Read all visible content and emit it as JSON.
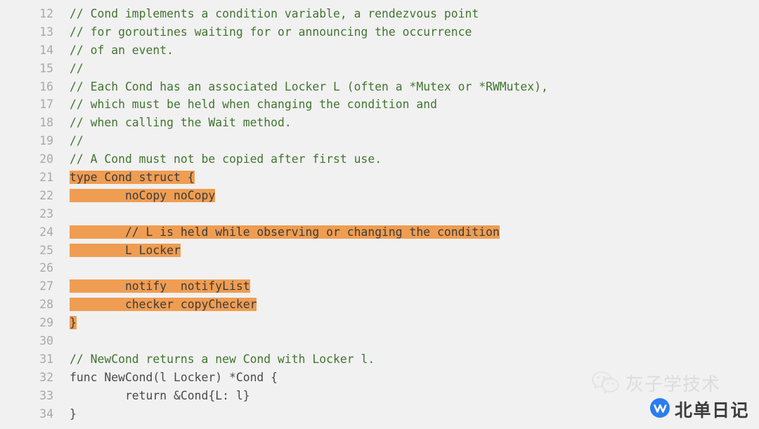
{
  "editor": {
    "language": "go",
    "background_color": "#f1f1f1",
    "gutter_color": "#a8a8a8",
    "comment_color": "#41752f",
    "code_color": "#4a4a4a",
    "highlight_color": "#ef9d52",
    "highlight_text_color": "#3c3c3c",
    "first_line_number": 12,
    "last_line_number": 34,
    "lines": [
      {
        "number": "12",
        "segments": [
          {
            "text": "// Cond implements a condition variable, a rendezvous point",
            "style": "comment",
            "highlight": false
          }
        ]
      },
      {
        "number": "13",
        "segments": [
          {
            "text": "// for goroutines waiting for or announcing the occurrence",
            "style": "comment",
            "highlight": false
          }
        ]
      },
      {
        "number": "14",
        "segments": [
          {
            "text": "// of an event.",
            "style": "comment",
            "highlight": false
          }
        ]
      },
      {
        "number": "15",
        "segments": [
          {
            "text": "//",
            "style": "comment",
            "highlight": false
          }
        ]
      },
      {
        "number": "16",
        "segments": [
          {
            "text": "// Each Cond has an associated Locker L (often a *Mutex or *RWMutex),",
            "style": "comment",
            "highlight": false
          }
        ]
      },
      {
        "number": "17",
        "segments": [
          {
            "text": "// which must be held when changing the condition and",
            "style": "comment",
            "highlight": false
          }
        ]
      },
      {
        "number": "18",
        "segments": [
          {
            "text": "// when calling the Wait method.",
            "style": "comment",
            "highlight": false
          }
        ]
      },
      {
        "number": "19",
        "segments": [
          {
            "text": "//",
            "style": "comment",
            "highlight": false
          }
        ]
      },
      {
        "number": "20",
        "segments": [
          {
            "text": "// A Cond must not be copied after first use.",
            "style": "comment",
            "highlight": false
          }
        ]
      },
      {
        "number": "21",
        "segments": [
          {
            "text": "type Cond struct {",
            "style": "code",
            "highlight": true
          }
        ]
      },
      {
        "number": "22",
        "segments": [
          {
            "text": "        noCopy noCopy",
            "style": "code",
            "highlight": true
          }
        ]
      },
      {
        "number": "23",
        "segments": []
      },
      {
        "number": "24",
        "segments": [
          {
            "text": "        // L is held while observing or changing the condition",
            "style": "code",
            "highlight": true
          }
        ]
      },
      {
        "number": "25",
        "segments": [
          {
            "text": "        L Locker",
            "style": "code",
            "highlight": true
          }
        ]
      },
      {
        "number": "26",
        "segments": []
      },
      {
        "number": "27",
        "segments": [
          {
            "text": "        notify  notifyList",
            "style": "code",
            "highlight": true
          }
        ]
      },
      {
        "number": "28",
        "segments": [
          {
            "text": "        checker copyChecker",
            "style": "code",
            "highlight": true
          }
        ]
      },
      {
        "number": "29",
        "segments": [
          {
            "text": "}",
            "style": "code",
            "highlight": true
          }
        ]
      },
      {
        "number": "30",
        "segments": []
      },
      {
        "number": "31",
        "segments": [
          {
            "text": "// NewCond returns a new Cond with Locker l.",
            "style": "comment",
            "highlight": false
          }
        ]
      },
      {
        "number": "32",
        "segments": [
          {
            "text": "func NewCond(l Locker) *Cond {",
            "style": "code",
            "highlight": false
          }
        ]
      },
      {
        "number": "33",
        "segments": [
          {
            "text": "        return &Cond{L: l}",
            "style": "code",
            "highlight": false
          }
        ]
      },
      {
        "number": "34",
        "segments": [
          {
            "text": "}",
            "style": "code",
            "highlight": false
          }
        ]
      }
    ]
  },
  "watermark": {
    "wechat_icon": "wechat-icon",
    "primary_text": "灰子学技术",
    "primary_text_color": "#dcdcdc",
    "badge_icon": "wechat-channels-icon",
    "badge_color": "#2b7cf0",
    "secondary_text": "北单日记",
    "secondary_text_color": "#3d3d3d"
  }
}
